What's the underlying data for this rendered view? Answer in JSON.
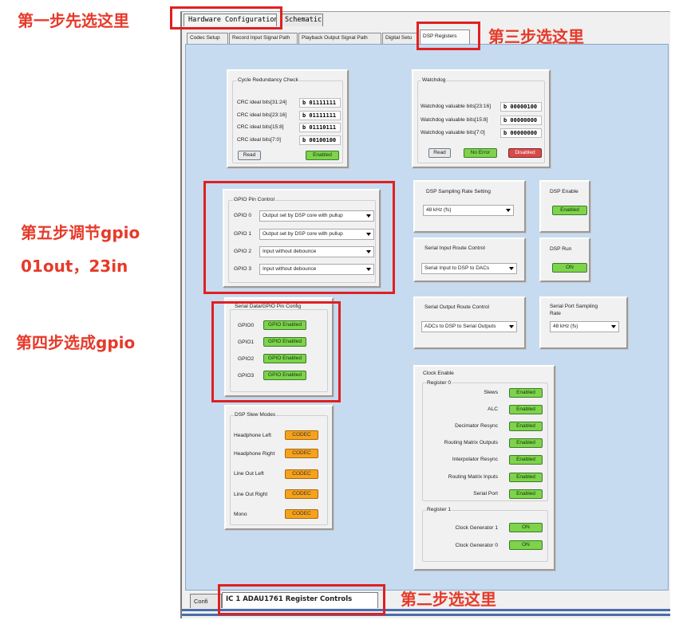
{
  "annotations": {
    "step1": "第一步先选这里",
    "step2": "第二步选这里",
    "step3": "第三步选这里",
    "step4": "第四步选成gpio",
    "step5_line1": "第五步调节gpio",
    "step5_line2": "01out，23in"
  },
  "top_tabs": [
    "Hardware Configuration",
    "Schematic"
  ],
  "sub_tabs": [
    "Codec Setup",
    "Record Input Signal Path",
    "Playback Output Signal Path",
    "Digital Setu",
    "DSP Registers"
  ],
  "crc": {
    "title": "Cycle Redundancy Check",
    "rows": [
      {
        "label": "CRC ideal bits[31:24]",
        "value": "b 01111111"
      },
      {
        "label": "CRC ideal bits[23:16]",
        "value": "b 01111111"
      },
      {
        "label": "CRC ideal bits[15:8]",
        "value": "b 01110111"
      },
      {
        "label": "CRC ideal bits[7:0]",
        "value": "b 00100100"
      }
    ],
    "read_button": "Read",
    "status": "Enabled"
  },
  "watchdog": {
    "title": "Watchdog",
    "rows": [
      {
        "label": "Watchdog valuable bits[23:16]",
        "value": "b 00000100"
      },
      {
        "label": "Watchdog valuable bits[15:8]",
        "value": "b 00000000"
      },
      {
        "label": "Watchdog valuable bits[7:0]",
        "value": "b 00000000"
      }
    ],
    "read_button": "Read",
    "error_status": "No Error",
    "enable_status": "Disabled"
  },
  "gpio_pin_control": {
    "title": "GPIO Pin Control",
    "rows": [
      {
        "label": "GPIO 0",
        "value": "Output set by DSP core with pullup"
      },
      {
        "label": "GPIO 1",
        "value": "Output set by DSP core with pullup"
      },
      {
        "label": "GPIO 2",
        "value": "Input without debounce"
      },
      {
        "label": "GPIO 3",
        "value": "Input without debounce"
      }
    ]
  },
  "dsp_sampling": {
    "title": "DSP Sampling Rate Setting",
    "value": "48 kHz (fs)"
  },
  "dsp_enable": {
    "title": "DSP Enable",
    "value": "Enabled"
  },
  "serial_input_route": {
    "title": "Serial Input Route Control",
    "value": "Serial Input to DSP to DACs"
  },
  "dsp_run": {
    "title": "DSP Run",
    "value": "ON"
  },
  "serial_output_route": {
    "title": "Serial Output Route Control",
    "value": "ADCs to DSP to Serial Outputs"
  },
  "serial_port_sampling": {
    "title_line1": "Serial Port Sampling",
    "title_line2": "Rate",
    "value": "48 kHz (fs)"
  },
  "serial_data_gpio": {
    "title": "Serial Data/GPIO Pin Config",
    "rows": [
      {
        "label": "GPIO0",
        "value": "GPIO Enabled"
      },
      {
        "label": "GPIO1",
        "value": "GPIO Enabled"
      },
      {
        "label": "GPIO2",
        "value": "GPIO Enabled"
      },
      {
        "label": "GPIO3",
        "value": "GPIO Enabled"
      }
    ]
  },
  "dsp_slew": {
    "title": "DSP Slew Modes",
    "rows": [
      {
        "label": "Headphone Left",
        "value": "CODEC"
      },
      {
        "label": "Headphone Right",
        "value": "CODEC"
      },
      {
        "label": "Line Out Left",
        "value": "CODEC"
      },
      {
        "label": "Line Out Right",
        "value": "CODEC"
      },
      {
        "label": "Mono",
        "value": "CODEC"
      }
    ]
  },
  "clock_enable": {
    "title": "Clock Enable",
    "register0": {
      "title": "Register 0",
      "rows": [
        {
          "label": "Slews",
          "value": "Enabled"
        },
        {
          "label": "ALC",
          "value": "Enabled"
        },
        {
          "label": "Decimator Resync",
          "value": "Enabled"
        },
        {
          "label": "Routing Matrix Outputs",
          "value": "Enabled"
        },
        {
          "label": "Interpolator Resync",
          "value": "Enabled"
        },
        {
          "label": "Routing Matrix Inputs",
          "value": "Enabled"
        },
        {
          "label": "Serial Port",
          "value": "Enabled"
        }
      ]
    },
    "register1": {
      "title": "Register 1",
      "rows": [
        {
          "label": "Clock Generator 1",
          "value": "ON"
        },
        {
          "label": "Clock Generator 0",
          "value": "ON"
        }
      ]
    }
  },
  "bottom_tabs": [
    "Confi",
    "IC 1   ADAU1761 Register Controls"
  ],
  "colors": {
    "annotation_red": "#e63a2a",
    "panel_bg": "#c6dbef",
    "status_green": "#7dd34a",
    "status_red": "#d94a4a",
    "status_orange": "#f7a21b"
  }
}
